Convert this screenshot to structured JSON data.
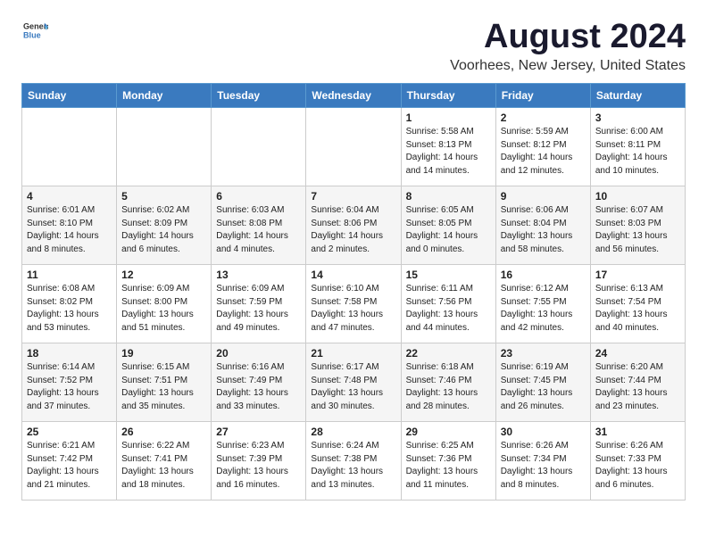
{
  "header": {
    "logo_general": "General",
    "logo_blue": "Blue",
    "month_year": "August 2024",
    "location": "Voorhees, New Jersey, United States"
  },
  "weekdays": [
    "Sunday",
    "Monday",
    "Tuesday",
    "Wednesday",
    "Thursday",
    "Friday",
    "Saturday"
  ],
  "weeks": [
    [
      {
        "day": "",
        "info": ""
      },
      {
        "day": "",
        "info": ""
      },
      {
        "day": "",
        "info": ""
      },
      {
        "day": "",
        "info": ""
      },
      {
        "day": "1",
        "info": "Sunrise: 5:58 AM\nSunset: 8:13 PM\nDaylight: 14 hours\nand 14 minutes."
      },
      {
        "day": "2",
        "info": "Sunrise: 5:59 AM\nSunset: 8:12 PM\nDaylight: 14 hours\nand 12 minutes."
      },
      {
        "day": "3",
        "info": "Sunrise: 6:00 AM\nSunset: 8:11 PM\nDaylight: 14 hours\nand 10 minutes."
      }
    ],
    [
      {
        "day": "4",
        "info": "Sunrise: 6:01 AM\nSunset: 8:10 PM\nDaylight: 14 hours\nand 8 minutes."
      },
      {
        "day": "5",
        "info": "Sunrise: 6:02 AM\nSunset: 8:09 PM\nDaylight: 14 hours\nand 6 minutes."
      },
      {
        "day": "6",
        "info": "Sunrise: 6:03 AM\nSunset: 8:08 PM\nDaylight: 14 hours\nand 4 minutes."
      },
      {
        "day": "7",
        "info": "Sunrise: 6:04 AM\nSunset: 8:06 PM\nDaylight: 14 hours\nand 2 minutes."
      },
      {
        "day": "8",
        "info": "Sunrise: 6:05 AM\nSunset: 8:05 PM\nDaylight: 14 hours\nand 0 minutes."
      },
      {
        "day": "9",
        "info": "Sunrise: 6:06 AM\nSunset: 8:04 PM\nDaylight: 13 hours\nand 58 minutes."
      },
      {
        "day": "10",
        "info": "Sunrise: 6:07 AM\nSunset: 8:03 PM\nDaylight: 13 hours\nand 56 minutes."
      }
    ],
    [
      {
        "day": "11",
        "info": "Sunrise: 6:08 AM\nSunset: 8:02 PM\nDaylight: 13 hours\nand 53 minutes."
      },
      {
        "day": "12",
        "info": "Sunrise: 6:09 AM\nSunset: 8:00 PM\nDaylight: 13 hours\nand 51 minutes."
      },
      {
        "day": "13",
        "info": "Sunrise: 6:09 AM\nSunset: 7:59 PM\nDaylight: 13 hours\nand 49 minutes."
      },
      {
        "day": "14",
        "info": "Sunrise: 6:10 AM\nSunset: 7:58 PM\nDaylight: 13 hours\nand 47 minutes."
      },
      {
        "day": "15",
        "info": "Sunrise: 6:11 AM\nSunset: 7:56 PM\nDaylight: 13 hours\nand 44 minutes."
      },
      {
        "day": "16",
        "info": "Sunrise: 6:12 AM\nSunset: 7:55 PM\nDaylight: 13 hours\nand 42 minutes."
      },
      {
        "day": "17",
        "info": "Sunrise: 6:13 AM\nSunset: 7:54 PM\nDaylight: 13 hours\nand 40 minutes."
      }
    ],
    [
      {
        "day": "18",
        "info": "Sunrise: 6:14 AM\nSunset: 7:52 PM\nDaylight: 13 hours\nand 37 minutes."
      },
      {
        "day": "19",
        "info": "Sunrise: 6:15 AM\nSunset: 7:51 PM\nDaylight: 13 hours\nand 35 minutes."
      },
      {
        "day": "20",
        "info": "Sunrise: 6:16 AM\nSunset: 7:49 PM\nDaylight: 13 hours\nand 33 minutes."
      },
      {
        "day": "21",
        "info": "Sunrise: 6:17 AM\nSunset: 7:48 PM\nDaylight: 13 hours\nand 30 minutes."
      },
      {
        "day": "22",
        "info": "Sunrise: 6:18 AM\nSunset: 7:46 PM\nDaylight: 13 hours\nand 28 minutes."
      },
      {
        "day": "23",
        "info": "Sunrise: 6:19 AM\nSunset: 7:45 PM\nDaylight: 13 hours\nand 26 minutes."
      },
      {
        "day": "24",
        "info": "Sunrise: 6:20 AM\nSunset: 7:44 PM\nDaylight: 13 hours\nand 23 minutes."
      }
    ],
    [
      {
        "day": "25",
        "info": "Sunrise: 6:21 AM\nSunset: 7:42 PM\nDaylight: 13 hours\nand 21 minutes."
      },
      {
        "day": "26",
        "info": "Sunrise: 6:22 AM\nSunset: 7:41 PM\nDaylight: 13 hours\nand 18 minutes."
      },
      {
        "day": "27",
        "info": "Sunrise: 6:23 AM\nSunset: 7:39 PM\nDaylight: 13 hours\nand 16 minutes."
      },
      {
        "day": "28",
        "info": "Sunrise: 6:24 AM\nSunset: 7:38 PM\nDaylight: 13 hours\nand 13 minutes."
      },
      {
        "day": "29",
        "info": "Sunrise: 6:25 AM\nSunset: 7:36 PM\nDaylight: 13 hours\nand 11 minutes."
      },
      {
        "day": "30",
        "info": "Sunrise: 6:26 AM\nSunset: 7:34 PM\nDaylight: 13 hours\nand 8 minutes."
      },
      {
        "day": "31",
        "info": "Sunrise: 6:26 AM\nSunset: 7:33 PM\nDaylight: 13 hours\nand 6 minutes."
      }
    ]
  ]
}
